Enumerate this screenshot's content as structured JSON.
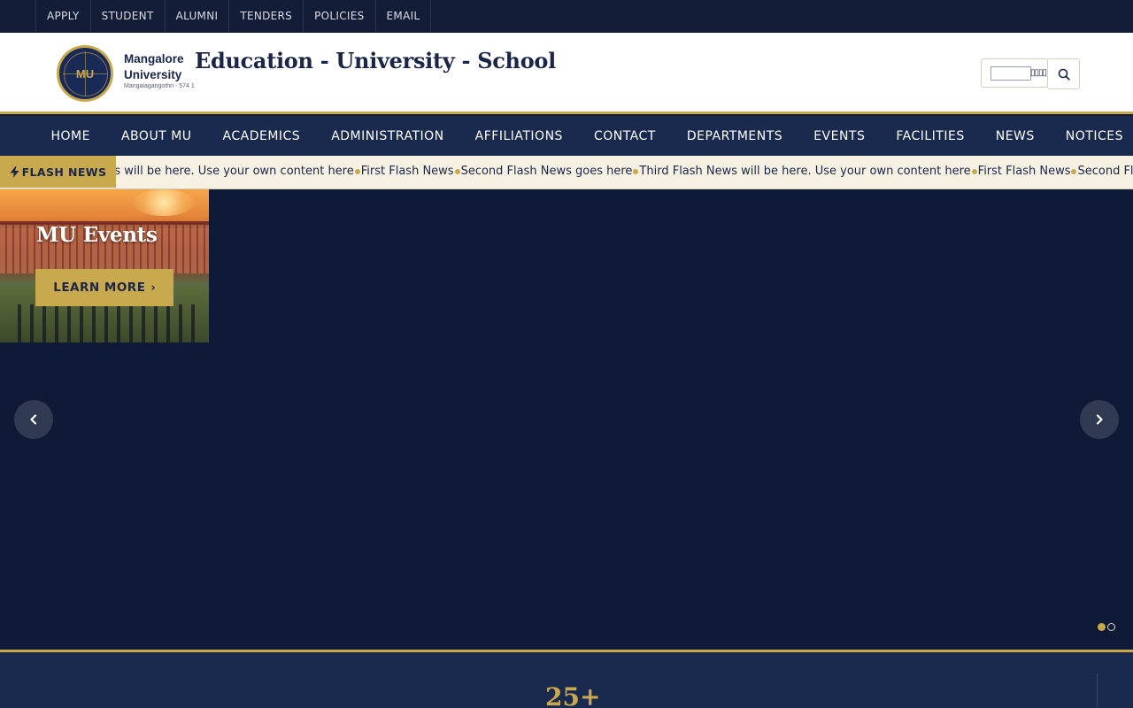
{
  "topbar": {
    "links": [
      "APPLY",
      "STUDENT",
      "ALUMNI",
      "TENDERS",
      "POLICIES",
      "EMAIL"
    ]
  },
  "header": {
    "logo_text": "MU",
    "university_line1": "Mangalore",
    "university_line2": "University",
    "university_subtitle": "Mangalagangothri - 574 1",
    "site_title": "Education - University - School",
    "search": {
      "placeholder": "",
      "glyphs": "▯▯▯▯"
    }
  },
  "nav": {
    "items": [
      "HOME",
      "ABOUT MU",
      "ACADEMICS",
      "ADMINISTRATION",
      "AFFILIATIONS",
      "CONTACT",
      "DEPARTMENTS",
      "EVENTS",
      "FACILITIES",
      "NEWS",
      "NOTICES"
    ]
  },
  "flash": {
    "label": "FLASH NEWS",
    "items": [
      "News will be here. Use your own content here",
      "First Flash News",
      "Second Flash News goes here",
      "Third Flash News will be here. Use your own content here",
      "First Flash News",
      "Second Flash News"
    ]
  },
  "slider": {
    "slide_title": "MU Events",
    "button_label": "LEARN MORE",
    "button_chevron": "›",
    "active_slide": 1,
    "total_slides": 2
  },
  "stats": {
    "first_value": "25+"
  },
  "colors": {
    "navy": "#0f1a36",
    "nav_bg": "#1a2a4f",
    "gold": "#c9a94e",
    "flash_bg": "#f6f1e2"
  }
}
